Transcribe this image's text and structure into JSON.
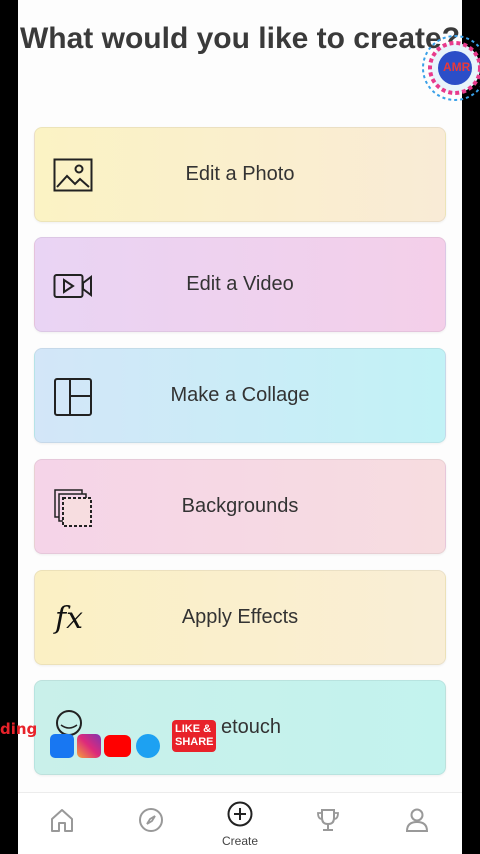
{
  "title": "What would you like to create?",
  "options": [
    {
      "label": "Edit a Photo",
      "icon": "photo-icon"
    },
    {
      "label": "Edit a Video",
      "icon": "video-icon"
    },
    {
      "label": "Make a Collage",
      "icon": "collage-icon"
    },
    {
      "label": "Backgrounds",
      "icon": "backgrounds-icon"
    },
    {
      "label": "Apply Effects",
      "icon": "fx-icon",
      "icon_text": "fx"
    },
    {
      "label": "Retouch",
      "label_visible": "etouch",
      "icon": "retouch-icon"
    }
  ],
  "bottom_nav": [
    {
      "name": "home",
      "icon": "home-icon",
      "label": ""
    },
    {
      "name": "discover",
      "icon": "compass-icon",
      "label": ""
    },
    {
      "name": "create",
      "icon": "plus-circle-icon",
      "label": "Create"
    },
    {
      "name": "challenges",
      "icon": "trophy-icon",
      "label": ""
    },
    {
      "name": "profile",
      "icon": "person-icon",
      "label": ""
    }
  ],
  "overlay": {
    "channel_logo_text": "AMR",
    "side_text": "ding",
    "like_share_text": "LIKE & SHARE"
  },
  "colors": {
    "title": "#3a3a3a",
    "label": "#333333",
    "photo_card": "#fbf3c4",
    "video_card": "#e9d4f4",
    "collage_card": "#c2f2f6",
    "backgrounds_card": "#f5d4e8",
    "effects_card": "#fbf0c4",
    "retouch_card": "#c3f3ee"
  }
}
